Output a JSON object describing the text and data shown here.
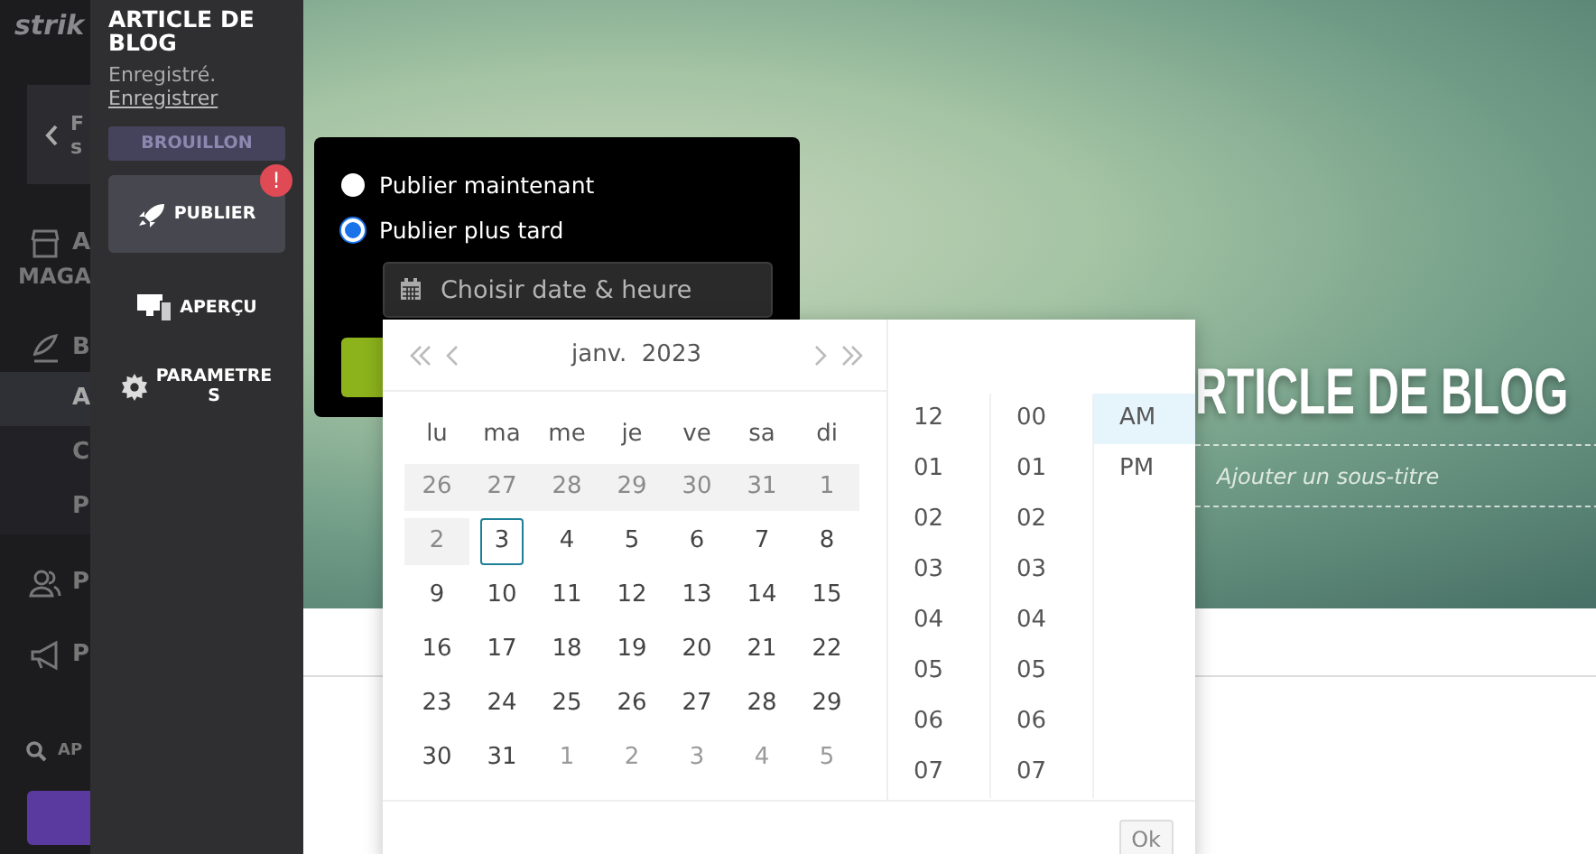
{
  "app_sidebar": {
    "logo": "strik",
    "back_button": [
      "F",
      "s"
    ],
    "items": [
      {
        "kind": "store",
        "lines": [
          "A",
          "MAGA"
        ]
      },
      {
        "kind": "blog",
        "lines": [
          "B"
        ]
      },
      {
        "kind": "sub",
        "lines": [
          "A"
        ],
        "selected": true
      },
      {
        "kind": "sub",
        "lines": [
          "C"
        ],
        "selected": false
      },
      {
        "kind": "sub",
        "lines": [
          "P"
        ],
        "selected": false
      },
      {
        "kind": "people",
        "lines": [
          "P"
        ]
      },
      {
        "kind": "megaphone",
        "lines": [
          "P"
        ]
      },
      {
        "kind": "search",
        "lines": [
          "AP"
        ]
      }
    ]
  },
  "editor_panel": {
    "title": "ARTICLE DE BLOG",
    "save_status": "Enregistré.",
    "save_link": "Enregistrer",
    "status_badge": "BROUILLON",
    "actions": [
      {
        "kind": "publish",
        "label": "PUBLIER",
        "selected": true,
        "alert": "!"
      },
      {
        "kind": "preview",
        "label": "APERÇU",
        "selected": false
      },
      {
        "kind": "settings",
        "label": "PARAMETRES",
        "selected": false
      }
    ]
  },
  "publish_popover": {
    "options": [
      {
        "label": "Publier maintenant",
        "selected": false
      },
      {
        "label": "Publier plus tard",
        "selected": true
      }
    ],
    "date_field": {
      "placeholder": "Choisir date & heure"
    }
  },
  "date_picker": {
    "month": "janv.  2023",
    "weekdays": [
      "lu",
      "ma",
      "me",
      "je",
      "ve",
      "sa",
      "di"
    ],
    "weeks": [
      [
        {
          "day": "26",
          "kind": "disabled"
        },
        {
          "day": "27",
          "kind": "disabled"
        },
        {
          "day": "28",
          "kind": "disabled"
        },
        {
          "day": "29",
          "kind": "disabled"
        },
        {
          "day": "30",
          "kind": "disabled"
        },
        {
          "day": "31",
          "kind": "disabled"
        },
        {
          "day": "1",
          "kind": "disabled"
        }
      ],
      [
        {
          "day": "2",
          "kind": "disabled"
        },
        {
          "day": "3",
          "kind": "today"
        },
        {
          "day": "4",
          "kind": "normal"
        },
        {
          "day": "5",
          "kind": "normal"
        },
        {
          "day": "6",
          "kind": "normal"
        },
        {
          "day": "7",
          "kind": "normal"
        },
        {
          "day": "8",
          "kind": "normal"
        }
      ],
      [
        {
          "day": "9",
          "kind": "normal"
        },
        {
          "day": "10",
          "kind": "normal"
        },
        {
          "day": "11",
          "kind": "normal"
        },
        {
          "day": "12",
          "kind": "normal"
        },
        {
          "day": "13",
          "kind": "normal"
        },
        {
          "day": "14",
          "kind": "normal"
        },
        {
          "day": "15",
          "kind": "normal"
        }
      ],
      [
        {
          "day": "16",
          "kind": "normal"
        },
        {
          "day": "17",
          "kind": "normal"
        },
        {
          "day": "18",
          "kind": "normal"
        },
        {
          "day": "19",
          "kind": "normal"
        },
        {
          "day": "20",
          "kind": "normal"
        },
        {
          "day": "21",
          "kind": "normal"
        },
        {
          "day": "22",
          "kind": "normal"
        }
      ],
      [
        {
          "day": "23",
          "kind": "normal"
        },
        {
          "day": "24",
          "kind": "normal"
        },
        {
          "day": "25",
          "kind": "normal"
        },
        {
          "day": "26",
          "kind": "normal"
        },
        {
          "day": "27",
          "kind": "normal"
        },
        {
          "day": "28",
          "kind": "normal"
        },
        {
          "day": "29",
          "kind": "normal"
        }
      ],
      [
        {
          "day": "30",
          "kind": "normal"
        },
        {
          "day": "31",
          "kind": "normal"
        },
        {
          "day": "1",
          "kind": "next"
        },
        {
          "day": "2",
          "kind": "next"
        },
        {
          "day": "3",
          "kind": "next"
        },
        {
          "day": "4",
          "kind": "next"
        },
        {
          "day": "5",
          "kind": "next"
        }
      ]
    ],
    "hours": [
      {
        "label": "12",
        "selected": false
      },
      {
        "label": "01",
        "selected": false
      },
      {
        "label": "02",
        "selected": false
      },
      {
        "label": "03",
        "selected": false
      },
      {
        "label": "04",
        "selected": false
      },
      {
        "label": "05",
        "selected": false
      },
      {
        "label": "06",
        "selected": false
      },
      {
        "label": "07",
        "selected": false
      }
    ],
    "minutes": [
      {
        "label": "00",
        "selected": false
      },
      {
        "label": "01",
        "selected": false
      },
      {
        "label": "02",
        "selected": false
      },
      {
        "label": "03",
        "selected": false
      },
      {
        "label": "04",
        "selected": false
      },
      {
        "label": "05",
        "selected": false
      },
      {
        "label": "06",
        "selected": false
      },
      {
        "label": "07",
        "selected": false
      }
    ],
    "meridiem": [
      {
        "label": "AM",
        "selected": true
      },
      {
        "label": "PM",
        "selected": false
      }
    ],
    "ok_button": {
      "label": "Ok",
      "disabled": true
    }
  },
  "hero": {
    "title": "RTICLE DE BLOG",
    "subtitle_placeholder": "Ajouter un sous-titre"
  }
}
